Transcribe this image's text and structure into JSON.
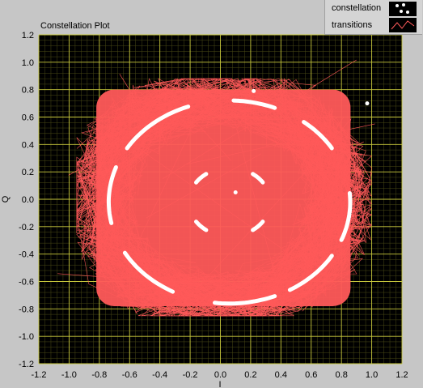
{
  "title": "Constellation Plot",
  "legend": [
    {
      "label": "constellation",
      "icon": "white-dots-icon"
    },
    {
      "label": "transitions",
      "icon": "red-zigzag-icon"
    }
  ],
  "colors": {
    "background": "#000000",
    "grid_major": "#c8c83c",
    "grid_minor": "#4a4a16",
    "transitions": "#ff5a5a",
    "constellation": "#ffffff",
    "panel": "#c6c6c6"
  },
  "chart_data": {
    "type": "scatter",
    "title": "Constellation Plot",
    "xlabel": "I",
    "ylabel": "Q",
    "xlim": [
      -1.2,
      1.2
    ],
    "ylim": [
      -1.2,
      1.2
    ],
    "x_ticks": [
      "-1.2",
      "-1.0",
      "-0.8",
      "-0.6",
      "-0.4",
      "-0.2",
      "0.0",
      "0.2",
      "0.4",
      "0.6",
      "0.8",
      "1.0",
      "1.2"
    ],
    "y_ticks": [
      "1.2",
      "1.0",
      "0.8",
      "0.6",
      "0.4",
      "0.2",
      "0.0",
      "-0.2",
      "-0.4",
      "-0.6",
      "-0.8",
      "-1.0",
      "-1.2"
    ],
    "grid": true,
    "legend_position": "top-right",
    "series": [
      {
        "name": "constellation",
        "arcs": [
          {
            "r": 0.95,
            "start_deg": 110,
            "end_deg": 148
          },
          {
            "r": 0.95,
            "start_deg": 68,
            "end_deg": 88
          },
          {
            "r": 0.95,
            "start_deg": 32,
            "end_deg": 52
          },
          {
            "r": 0.95,
            "start_deg": -22,
            "end_deg": 5
          },
          {
            "r": 0.95,
            "start_deg": -60,
            "end_deg": -32
          },
          {
            "r": 0.95,
            "start_deg": -97,
            "end_deg": -68
          },
          {
            "r": 0.95,
            "start_deg": -150,
            "end_deg": -118
          },
          {
            "r": 0.95,
            "start_deg": 160,
            "end_deg": 192
          },
          {
            "r": 0.32,
            "start_deg": 125,
            "end_deg": 145
          },
          {
            "r": 0.32,
            "start_deg": 35,
            "end_deg": 55
          },
          {
            "r": 0.32,
            "start_deg": -55,
            "end_deg": -35
          },
          {
            "r": 0.32,
            "start_deg": -145,
            "end_deg": -125
          }
        ],
        "points": [
          [
            0.1,
            0.05
          ],
          [
            0.22,
            0.79
          ],
          [
            0.97,
            0.7
          ]
        ]
      },
      {
        "name": "transitions",
        "extent": {
          "i_min": -0.95,
          "i_max": 1.0,
          "q_min": -0.85,
          "q_max": 0.88
        }
      }
    ]
  }
}
